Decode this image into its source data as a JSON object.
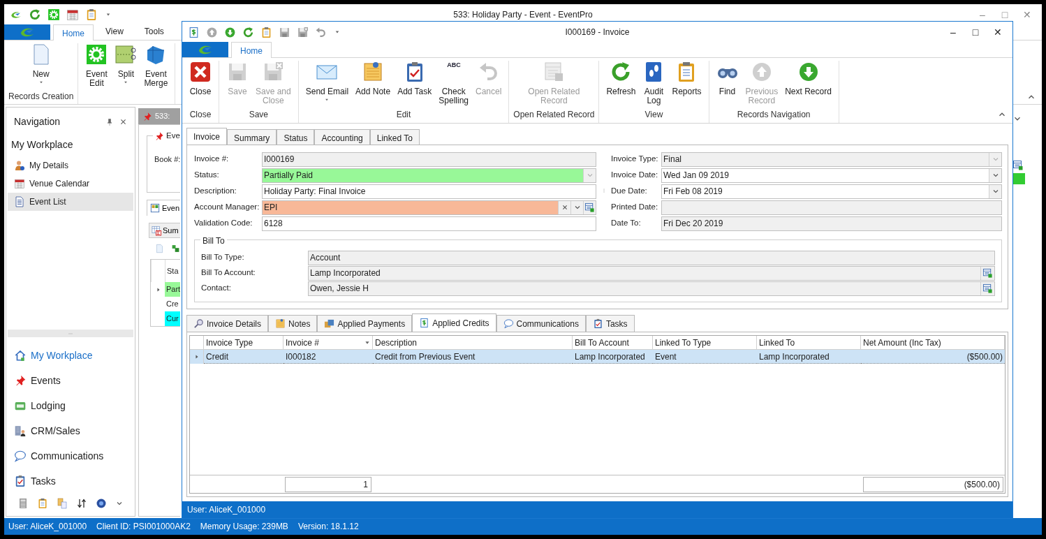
{
  "main_window": {
    "title": "533: Holiday Party - Event - EventPro",
    "window_controls": [
      "–",
      "□",
      "✕"
    ],
    "ribbon_tabs": [
      {
        "label": "Home",
        "selected": true
      },
      {
        "label": "View",
        "selected": false
      },
      {
        "label": "Tools",
        "selected": false
      }
    ],
    "ribbon_groups": [
      {
        "label": "Records Creation",
        "buttons": [
          {
            "label": "New",
            "dropdown": true
          }
        ]
      },
      {
        "buttons": [
          {
            "label": "Event\nEdit",
            "dropdown": false
          },
          {
            "label": "Split",
            "dropdown": true
          },
          {
            "label": "Event\nMerge",
            "dropdown": false
          }
        ]
      }
    ],
    "navigation": {
      "title": "Navigation",
      "section": "My Workplace",
      "items": [
        {
          "label": "My Details",
          "selected": false
        },
        {
          "label": "Venue Calendar",
          "selected": false
        },
        {
          "label": "Event List",
          "selected": true
        }
      ],
      "modules": [
        {
          "label": "My Workplace",
          "selected": true
        },
        {
          "label": "Events",
          "selected": false
        },
        {
          "label": "Lodging",
          "selected": false
        },
        {
          "label": "CRM/Sales",
          "selected": false
        },
        {
          "label": "Communications",
          "selected": false
        },
        {
          "label": "Tasks",
          "selected": false
        }
      ]
    },
    "document_tab": "533:",
    "group_caption": "Eve",
    "book_label": "Book #:",
    "event_tab": "Even",
    "summary_tab": "Sum",
    "grid": {
      "column": "Sta",
      "rows": [
        {
          "text": "Part",
          "color": "#98f898"
        },
        {
          "text": "Cre",
          "color": "#ffffff"
        },
        {
          "text": "Cur",
          "color": "#00ffff"
        }
      ]
    },
    "status_bar": [
      "User: AliceK_001000",
      "Client ID: PSI001000AK2",
      "Memory Usage: 239MB",
      "Version: 18.1.12"
    ]
  },
  "invoice_window": {
    "title": "I000169 - Invoice",
    "window_controls": [
      "–",
      "□",
      "✕"
    ],
    "ribbon_tabs": [
      {
        "label": "Home",
        "selected": true
      }
    ],
    "ribbon_groups": [
      {
        "label": "Close",
        "buttons": [
          {
            "label": "Close",
            "disabled": false,
            "dropdown": false
          }
        ]
      },
      {
        "label": "Save",
        "buttons": [
          {
            "label": "Save",
            "disabled": true,
            "dropdown": false
          },
          {
            "label": "Save and\nClose",
            "disabled": true,
            "dropdown": false
          }
        ]
      },
      {
        "label": "Edit",
        "buttons": [
          {
            "label": "Send Email",
            "disabled": false,
            "dropdown": true
          },
          {
            "label": "Add Note",
            "disabled": false,
            "dropdown": false
          },
          {
            "label": "Add Task",
            "disabled": false,
            "dropdown": false
          },
          {
            "label": "Check\nSpelling",
            "disabled": false,
            "dropdown": false,
            "icon_text": "ABC"
          },
          {
            "label": "Cancel",
            "disabled": true,
            "dropdown": false
          }
        ]
      },
      {
        "label": "Open Related Record",
        "buttons": [
          {
            "label": "Open Related\nRecord",
            "disabled": true,
            "dropdown": false
          }
        ]
      },
      {
        "label": "View",
        "buttons": [
          {
            "label": "Refresh",
            "disabled": false,
            "dropdown": false
          },
          {
            "label": "Audit\nLog",
            "disabled": false,
            "dropdown": false
          },
          {
            "label": "Reports",
            "disabled": false,
            "dropdown": false
          }
        ]
      },
      {
        "label": "Records Navigation",
        "buttons": [
          {
            "label": "Find",
            "disabled": false,
            "dropdown": false
          },
          {
            "label": "Previous\nRecord",
            "disabled": true,
            "dropdown": false
          },
          {
            "label": "Next Record",
            "disabled": false,
            "dropdown": false
          }
        ]
      }
    ],
    "tabs": [
      {
        "label": "Invoice",
        "selected": true
      },
      {
        "label": "Summary",
        "selected": false
      },
      {
        "label": "Status",
        "selected": false
      },
      {
        "label": "Accounting",
        "selected": false
      },
      {
        "label": "Linked To",
        "selected": false
      }
    ],
    "fields_left": [
      {
        "label": "Invoice #:",
        "value": "I000169",
        "kind": "text",
        "readonly": true
      },
      {
        "label": "Status:",
        "value": "Partially Paid",
        "kind": "combo",
        "readonly": true,
        "color": "#98f898"
      },
      {
        "label": "Description:",
        "value": "Holiday Party: Final Invoice",
        "kind": "text",
        "readonly": false
      },
      {
        "label": "Account Manager:",
        "value": "EPI",
        "kind": "lookup_combo",
        "readonly": false,
        "color": "#f8b898"
      },
      {
        "label": "Validation Code:",
        "value": "6128",
        "kind": "text",
        "readonly": false
      }
    ],
    "fields_right": [
      {
        "label": "Invoice Type:",
        "value": "Final",
        "kind": "combo",
        "readonly": true
      },
      {
        "label": "Invoice Date:",
        "value": "Wed Jan 09 2019",
        "kind": "combo",
        "readonly": false
      },
      {
        "label": "Due Date:",
        "value": "Fri Feb 08 2019",
        "kind": "combo",
        "readonly": false
      },
      {
        "label": "Printed Date:",
        "kind": "text",
        "readonly": true
      },
      {
        "label": "Date To:",
        "value": "Fri Dec 20 2019",
        "kind": "text",
        "readonly": true
      }
    ],
    "bill_to": {
      "title": "Bill To",
      "fields": [
        {
          "label": "Bill To Type:",
          "value": "Account",
          "kind": "text",
          "readonly": true
        },
        {
          "label": "Bill To Account:",
          "value": "Lamp Incorporated",
          "kind": "lookup",
          "readonly": true
        },
        {
          "label": "Contact:",
          "value": "Owen, Jessie H",
          "kind": "lookup",
          "readonly": true
        }
      ]
    },
    "detail_tabs": [
      {
        "label": "Invoice Details",
        "selected": false
      },
      {
        "label": "Notes",
        "selected": false
      },
      {
        "label": "Applied Payments",
        "selected": false
      },
      {
        "label": "Applied Credits",
        "selected": true
      },
      {
        "label": "Communications",
        "selected": false
      },
      {
        "label": "Tasks",
        "selected": false
      }
    ],
    "grid": {
      "columns": [
        {
          "label": "Invoice Type",
          "sort_arrow": false
        },
        {
          "label": "Invoice #",
          "sort_arrow": true
        },
        {
          "label": "Description",
          "sort_arrow": false
        },
        {
          "label": "Bill To Account",
          "sort_arrow": false
        },
        {
          "label": "Linked To Type",
          "sort_arrow": false
        },
        {
          "label": "Linked To",
          "sort_arrow": false
        },
        {
          "label": "Net Amount (Inc Tax)",
          "sort_arrow": false
        }
      ],
      "rows": [
        {
          "selected": true,
          "cells": [
            "Credit",
            "I000182",
            "Credit from Previous Event",
            "Lamp Incorporated",
            "Event",
            "Lamp Incorporated",
            "($500.00)"
          ]
        }
      ],
      "footer": {
        "count": "1",
        "total": "($500.00)"
      }
    },
    "status_bar": "User: AliceK_001000"
  }
}
